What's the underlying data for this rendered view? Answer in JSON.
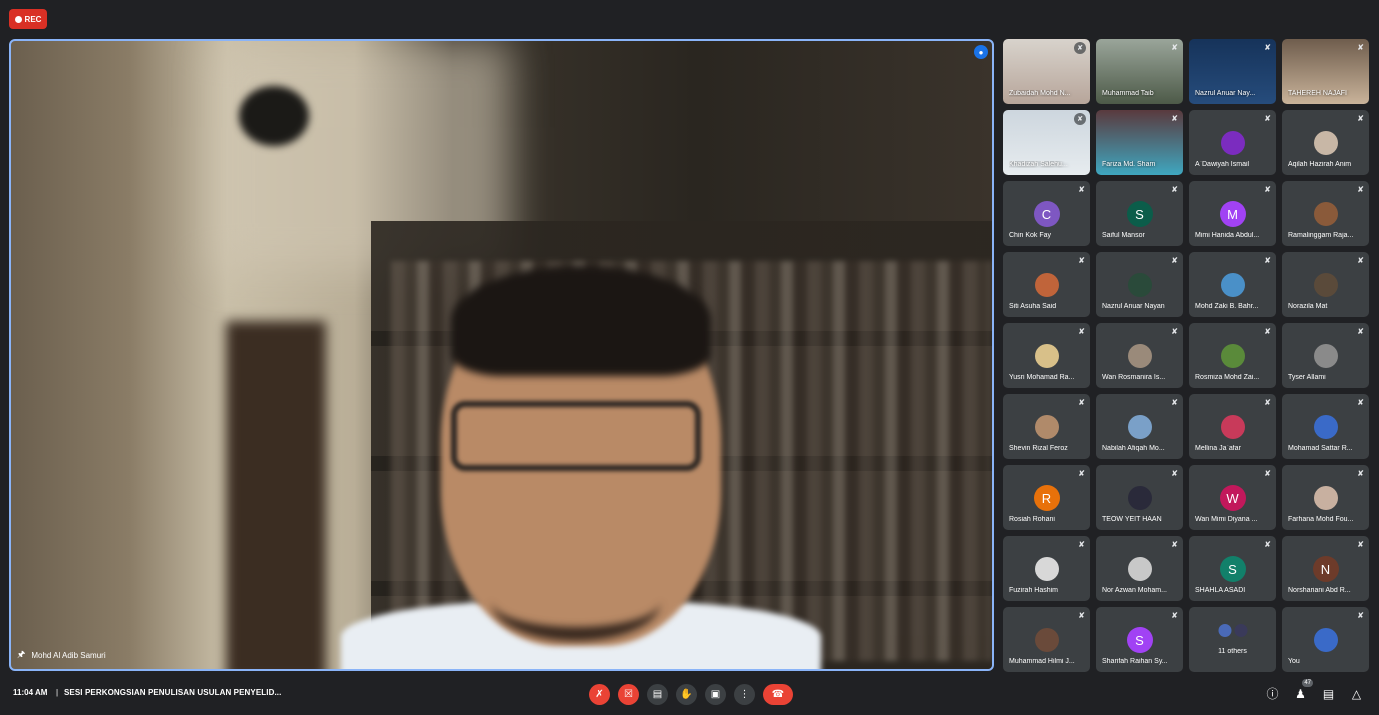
{
  "recording": {
    "label": "REC"
  },
  "main": {
    "speaker_name": "Mohd Al Adib Samuri"
  },
  "participants": [
    {
      "name": "Zubaidah Mohd N...",
      "type": "video",
      "bg": "linear-gradient(180deg,#d8d3cc,#b7a59a)",
      "mic_icon": "bubble"
    },
    {
      "name": "Muhammad Taib",
      "type": "video",
      "bg": "linear-gradient(180deg,#9aa59a,#4d5a48)",
      "mic_icon": "normal"
    },
    {
      "name": "Nazrul Anuar Nay...",
      "type": "video",
      "bg": "linear-gradient(180deg,#16335a,#264c7c)",
      "mic_icon": "normal"
    },
    {
      "name": "TAHEREH NAJAFI",
      "type": "video",
      "bg": "linear-gradient(180deg,#6f5d4d,#c9b39a)",
      "mic_icon": "normal"
    },
    {
      "name": "Khadizah Salehu...",
      "type": "video",
      "bg": "linear-gradient(180deg,#cdd6de,#e7ecef)",
      "mic_icon": "bubble"
    },
    {
      "name": "Fariza Md. Sham",
      "type": "video",
      "bg": "linear-gradient(180deg,#5a3a3e,#3fa7c0)",
      "mic_icon": "normal"
    },
    {
      "name": "A`Dawiyah Ismail",
      "type": "photo",
      "color": "#7b2cbf",
      "mic_icon": "normal"
    },
    {
      "name": "Aqilah Hazirah Anim",
      "type": "photo",
      "color": "#c8b7a6",
      "mic_icon": "normal"
    },
    {
      "name": "Chin Kok Fay",
      "type": "letter",
      "letter": "C",
      "color": "#7e57c2",
      "mic_icon": "normal"
    },
    {
      "name": "Saiful Mansor",
      "type": "letter",
      "letter": "S",
      "color": "#0b5d4a",
      "mic_icon": "normal"
    },
    {
      "name": "Mimi Hanida Abdul...",
      "type": "letter",
      "letter": "M",
      "color": "#a142f4",
      "mic_icon": "normal"
    },
    {
      "name": "Ramalinggam Raja...",
      "type": "photo",
      "color": "#8a5a3a",
      "mic_icon": "normal"
    },
    {
      "name": "Siti Asuha Said",
      "type": "photo",
      "color": "#c0643a",
      "mic_icon": "normal"
    },
    {
      "name": "Nazrul Anuar Nayan",
      "type": "photo",
      "color": "#2a4a3a",
      "mic_icon": "normal"
    },
    {
      "name": "Mohd Zaki B. Bahr...",
      "type": "photo",
      "color": "#4a90c8",
      "mic_icon": "normal"
    },
    {
      "name": "Norazila Mat",
      "type": "photo",
      "color": "#5a4a3a",
      "mic_icon": "normal"
    },
    {
      "name": "Yusri Mohamad Ra...",
      "type": "photo",
      "color": "#d8c089",
      "mic_icon": "normal"
    },
    {
      "name": "Wan Rosmanira Is...",
      "type": "photo",
      "color": "#9a8a7a",
      "mic_icon": "normal"
    },
    {
      "name": "Rosmiza Mohd Zai...",
      "type": "photo",
      "color": "#5a8a3a",
      "mic_icon": "normal"
    },
    {
      "name": "Tyser Allami",
      "type": "photo",
      "color": "#8a8a8a",
      "mic_icon": "normal"
    },
    {
      "name": "Shevin Rizal Feroz",
      "type": "photo",
      "color": "#b08a6a",
      "mic_icon": "normal"
    },
    {
      "name": "Nabilah Afiqah Mo...",
      "type": "photo",
      "color": "#7aa0c8",
      "mic_icon": "normal"
    },
    {
      "name": "Mellina Ja`afar",
      "type": "photo",
      "color": "#c83a5a",
      "mic_icon": "normal"
    },
    {
      "name": "Mohamad Sattar R...",
      "type": "photo",
      "color": "#3a6ac8",
      "mic_icon": "normal"
    },
    {
      "name": "Rosiah Rohani",
      "type": "letter",
      "letter": "R",
      "color": "#e8710a",
      "mic_icon": "normal"
    },
    {
      "name": "TEOW YEIT HAAN",
      "type": "photo",
      "color": "#2a2a3a",
      "mic_icon": "normal"
    },
    {
      "name": "Wan Mimi Diyana ...",
      "type": "letter",
      "letter": "W",
      "color": "#c2185b",
      "mic_icon": "normal"
    },
    {
      "name": "Farhana Mohd Fou...",
      "type": "photo",
      "color": "#c8b0a0",
      "mic_icon": "normal"
    },
    {
      "name": "Fuzirah Hashim",
      "type": "photo",
      "color": "#d8d8d8",
      "mic_icon": "normal"
    },
    {
      "name": "Nor Azwan Moham...",
      "type": "photo",
      "color": "#c8c8c8",
      "mic_icon": "normal"
    },
    {
      "name": "SHAHLA ASADI",
      "type": "letter",
      "letter": "S",
      "color": "#12806a",
      "mic_icon": "normal"
    },
    {
      "name": "Norshariani Abd R...",
      "type": "letter",
      "letter": "N",
      "color": "#6d3b2a",
      "mic_icon": "normal"
    },
    {
      "name": "Muhammad Hilmi J...",
      "type": "photo",
      "color": "#6a4a3a",
      "mic_icon": "normal"
    },
    {
      "name": "Sharifah Raihan Sy...",
      "type": "letter",
      "letter": "S",
      "color": "#a142f4",
      "mic_icon": "normal"
    },
    {
      "name": "11 others",
      "type": "others",
      "mic_icon": "none"
    },
    {
      "name": "You",
      "type": "photo",
      "color": "#3a6ac8",
      "mic_icon": "normal"
    }
  ],
  "bottom_bar": {
    "time": "11:04 AM",
    "separator": "|",
    "meeting_title": "SESI PERKONGSIAN PENULISAN USULAN PENYELID...",
    "participant_count": "47"
  }
}
